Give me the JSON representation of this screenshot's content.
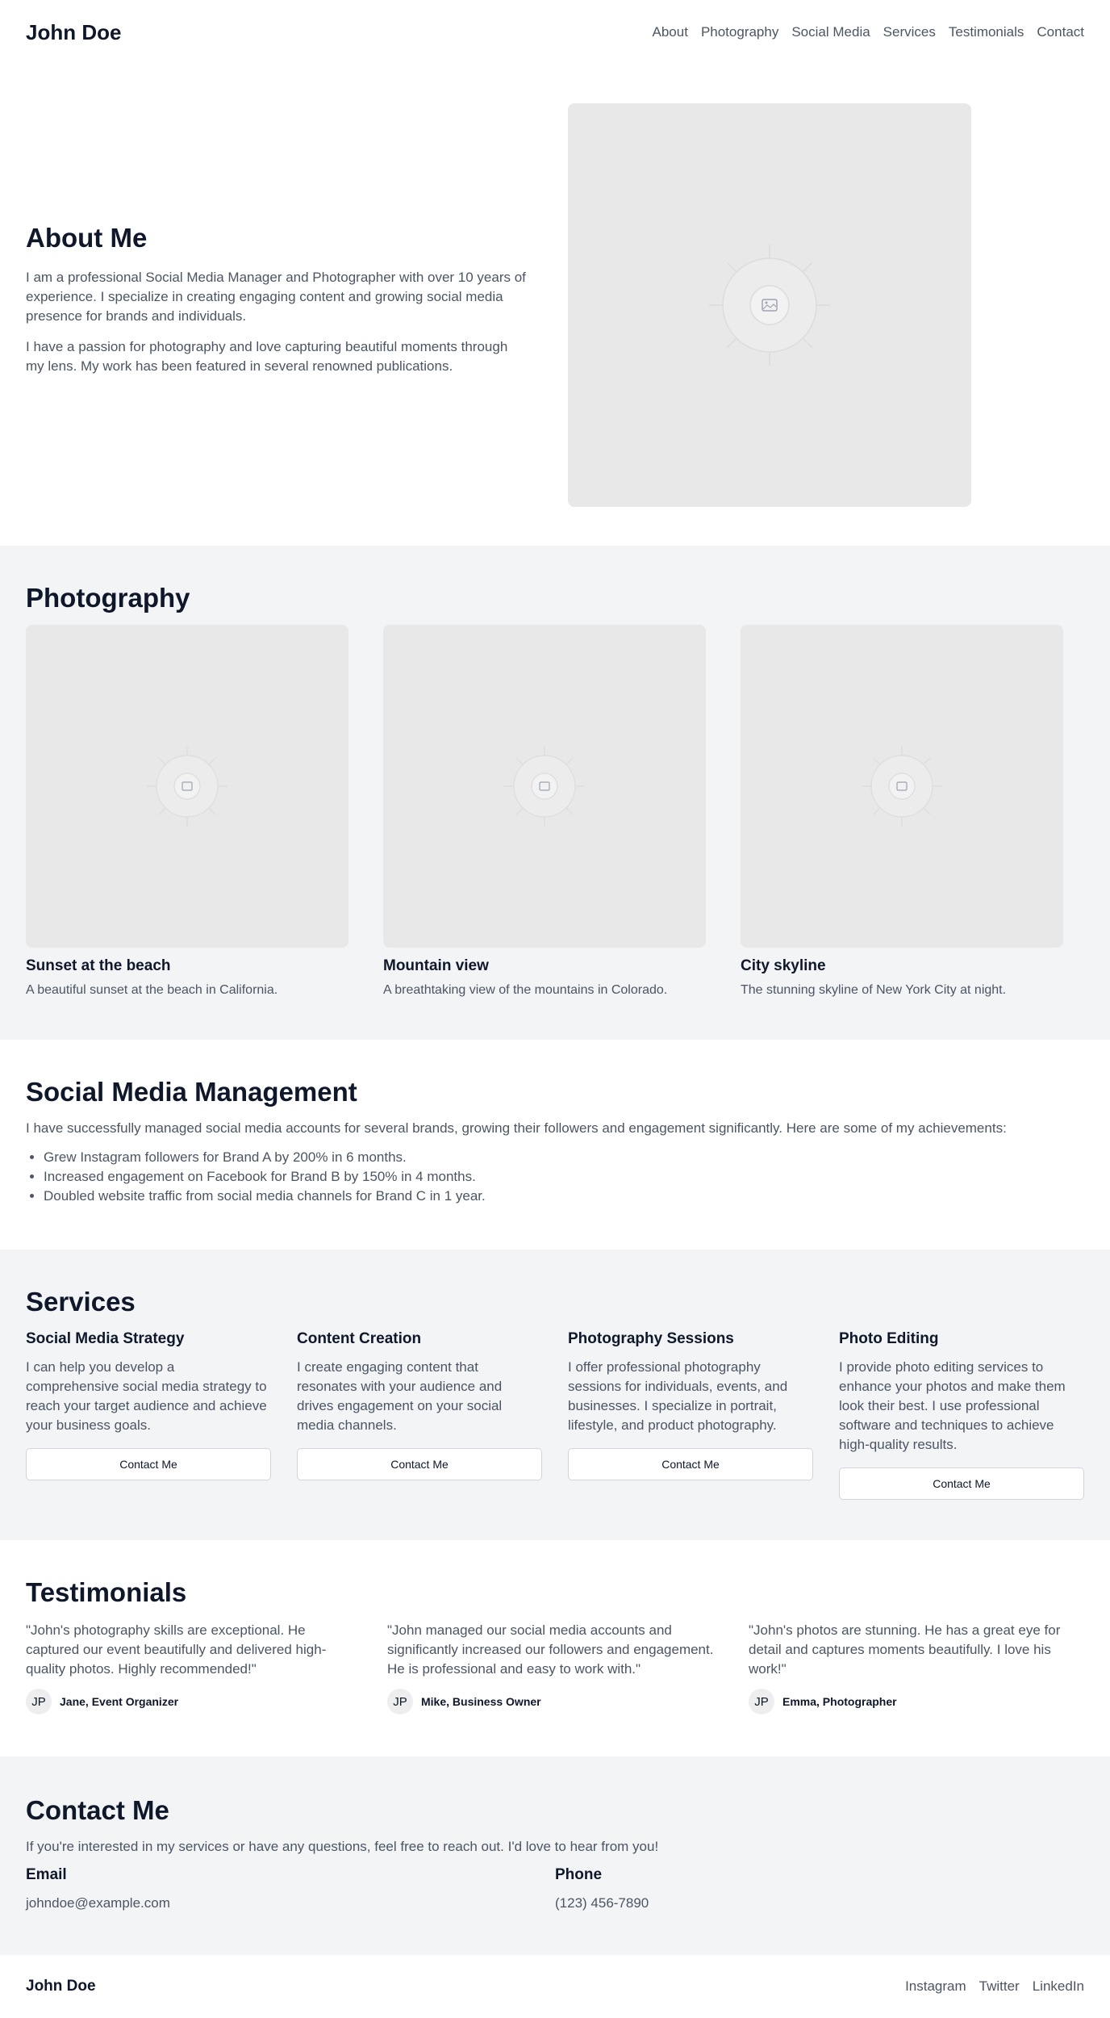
{
  "header": {
    "brand": "John Doe",
    "nav": [
      "About",
      "Photography",
      "Social Media",
      "Services",
      "Testimonials",
      "Contact"
    ]
  },
  "about": {
    "title": "About Me",
    "paragraphs": [
      "I am a professional Social Media Manager and Photographer with over 10 years of experience. I specialize in creating engaging content and growing social media presence for brands and individuals.",
      "I have a passion for photography and love capturing beautiful moments through my lens. My work has been featured in several renowned publications."
    ],
    "image_icon": "image-placeholder-icon"
  },
  "photography": {
    "title": "Photography",
    "items": [
      {
        "title": "Sunset at the beach",
        "description": "A beautiful sunset at the beach in California."
      },
      {
        "title": "Mountain view",
        "description": "A breathtaking view of the mountains in Colorado."
      },
      {
        "title": "City skyline",
        "description": "The stunning skyline of New York City at night."
      }
    ]
  },
  "social": {
    "title": "Social Media Management",
    "intro": "I have successfully managed social media accounts for several brands, growing their followers and engagement significantly. Here are some of my achievements:",
    "achievements": [
      "Grew Instagram followers for Brand A by 200% in 6 months.",
      "Increased engagement on Facebook for Brand B by 150% in 4 months.",
      "Doubled website traffic from social media channels for Brand C in 1 year."
    ]
  },
  "services": {
    "title": "Services",
    "items": [
      {
        "title": "Social Media Strategy",
        "description": "I can help you develop a comprehensive social media strategy to reach your target audience and achieve your business goals.",
        "button": "Contact Me"
      },
      {
        "title": "Content Creation",
        "description": "I create engaging content that resonates with your audience and drives engagement on your social media channels.",
        "button": "Contact Me"
      },
      {
        "title": "Photography Sessions",
        "description": "I offer professional photography sessions for individuals, events, and businesses. I specialize in portrait, lifestyle, and product photography.",
        "button": "Contact Me"
      },
      {
        "title": "Photo Editing",
        "description": "I provide photo editing services to enhance your photos and make them look their best. I use professional software and techniques to achieve high-quality results.",
        "button": "Contact Me"
      }
    ]
  },
  "testimonials": {
    "title": "Testimonials",
    "items": [
      {
        "quote": "\"John's photography skills are exceptional. He captured our event beautifully and delivered high-quality photos. Highly recommended!\"",
        "initials": "JP",
        "author": "Jane, Event Organizer"
      },
      {
        "quote": "\"John managed our social media accounts and significantly increased our followers and engagement. He is professional and easy to work with.\"",
        "initials": "JP",
        "author": "Mike, Business Owner"
      },
      {
        "quote": "\"John's photos are stunning. He has a great eye for detail and captures moments beautifully. I love his work!\"",
        "initials": "JP",
        "author": "Emma, Photographer"
      }
    ]
  },
  "contact": {
    "title": "Contact Me",
    "intro": "If you're interested in my services or have any questions, feel free to reach out. I'd love to hear from you!",
    "email_label": "Email",
    "email": "johndoe@example.com",
    "phone_label": "Phone",
    "phone": "(123) 456-7890"
  },
  "footer": {
    "brand": "John Doe",
    "links": [
      "Instagram",
      "Twitter",
      "LinkedIn"
    ]
  },
  "colors": {
    "text_dark": "#0f172a",
    "text_muted": "#4b5563",
    "section_alt_bg": "#f3f4f6",
    "placeholder_bg": "#e8e8e8"
  }
}
